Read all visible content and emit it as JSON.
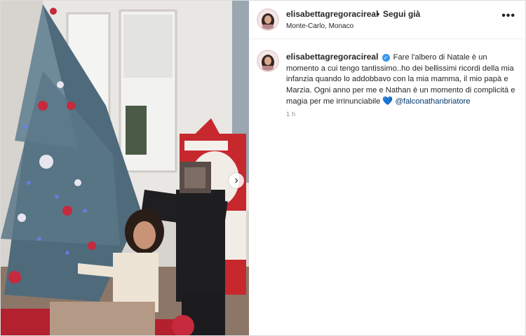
{
  "post": {
    "username": "elisabettagregoraci real",
    "username_display": "elisabettagregoracireal",
    "separator": "•",
    "follow_label": "Segui già",
    "location": "Monte-Carlo, Monaco",
    "more_icon": "•••",
    "caption": {
      "text_1": "Fare l'albero di Natale è un momento a cui tengo tantissimo..ho dei bellissimi ricordi della mia infanzia quando lo addobbavo con la mia mamma, il mio papà e Marzia. Ogni anno per me e Nathan è un momento di complicità e magia per me irrinunciabile",
      "heart_icon": "💙",
      "mention": "@falconathanbriatore"
    },
    "time_ago": "1 h",
    "verified_icon": "✓",
    "next_icon": "›"
  },
  "colors": {
    "verified": "#3897f0",
    "mention": "#00376b",
    "heart": "#1d5fb5"
  }
}
